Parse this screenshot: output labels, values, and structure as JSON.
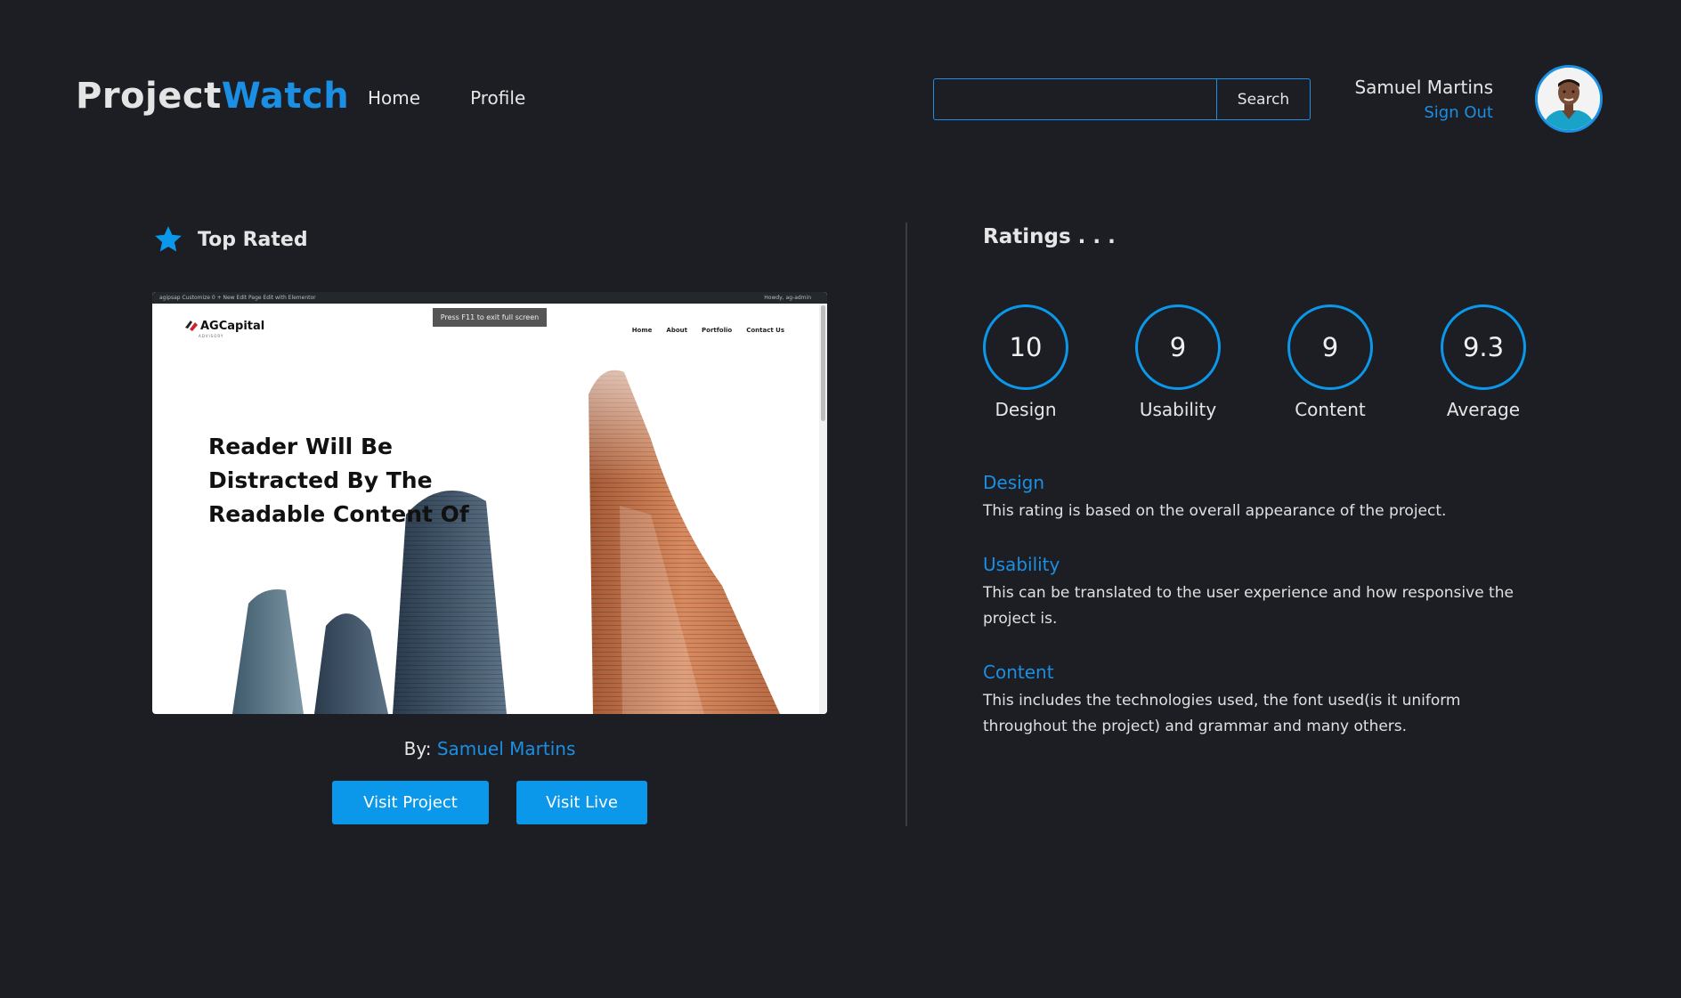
{
  "header": {
    "logo_part1": "Project",
    "logo_part2": "Watch",
    "nav": [
      "Home",
      "Profile"
    ],
    "search_placeholder": "",
    "search_button": "Search",
    "user_name": "Samuel Martins",
    "sign_out": "Sign Out"
  },
  "top_rated": {
    "title": "Top Rated",
    "preview": {
      "admin_bar_left": "agipsap  Customize  0  + New  Edit Page  Edit with Elementor",
      "admin_bar_right": "Howdy, ag-admin",
      "fullscreen_hint": "Press F11 to exit full screen",
      "brand": "AGCapital",
      "brand_tagline": "ADVISORY",
      "menu": [
        "Home",
        "About",
        "Portfolio",
        "Contact Us"
      ],
      "headline": [
        "Reader Will Be",
        "Distracted By The",
        "Readable Content Of"
      ]
    },
    "by_label": "By:",
    "author": "Samuel Martins",
    "visit_project": "Visit Project",
    "visit_live": "Visit Live"
  },
  "ratings": {
    "title": "Ratings . . .",
    "scores": [
      {
        "value": "10",
        "label": "Design"
      },
      {
        "value": "9",
        "label": "Usability"
      },
      {
        "value": "9",
        "label": "Content"
      },
      {
        "value": "9.3",
        "label": "Average"
      }
    ],
    "descriptions": [
      {
        "title": "Design",
        "text": "This rating is based on the overall appearance of the project."
      },
      {
        "title": "Usability",
        "text": "This can be translated to the user experience and how responsive the project is."
      },
      {
        "title": "Content",
        "text": "This includes the technologies used, the font used(is it uniform throughout the project) and grammar and many others."
      }
    ]
  },
  "colors": {
    "accent": "#1a8fe3",
    "button": "#0b98ea",
    "background": "#1c1e24"
  }
}
